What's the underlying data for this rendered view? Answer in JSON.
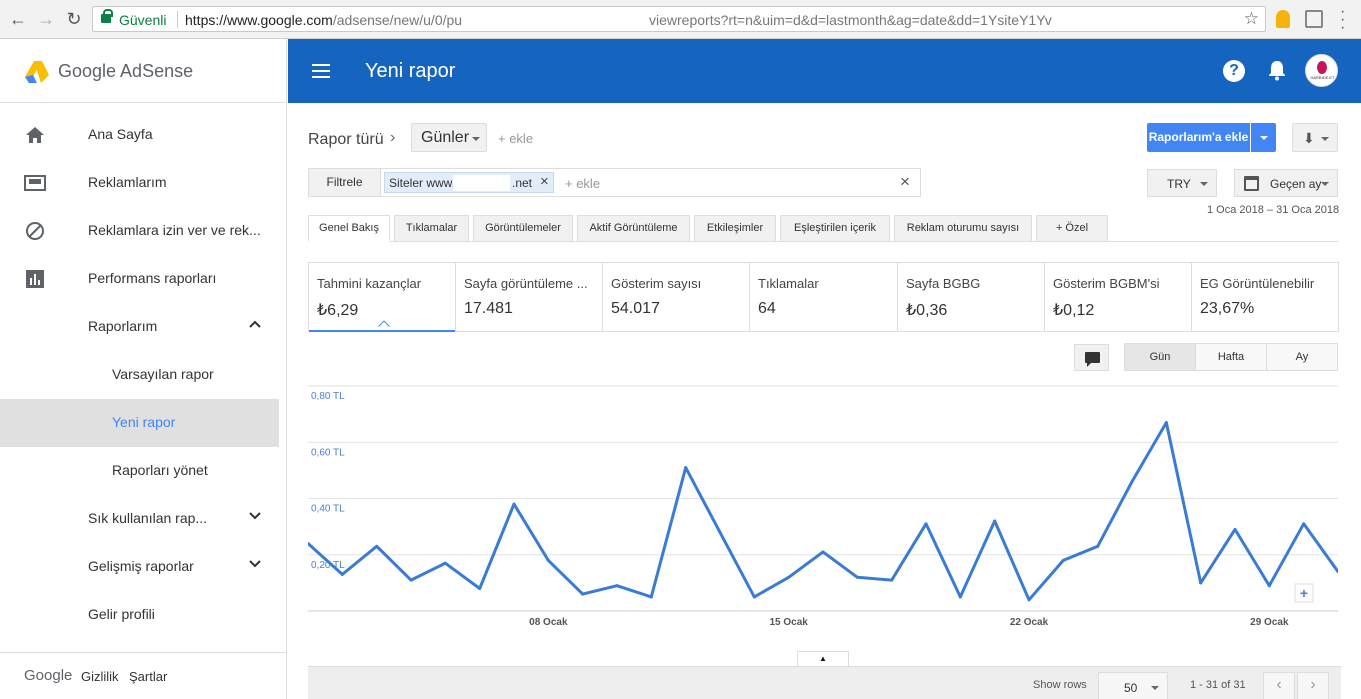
{
  "browser": {
    "secure_label": "Güvenli",
    "url_host": "https://www.google.com",
    "url_path": "/adsense/new/u/0/pu",
    "url_tail": "viewreports?rt=n&uim=d&d=lastmonth&ag=date&dd=1YsiteY1Yv"
  },
  "app": {
    "logo_text": "Google AdSense",
    "page_title": "Yeni rapor"
  },
  "sidebar": {
    "items": [
      {
        "label": "Ana Sayfa",
        "icon": "home-icon"
      },
      {
        "label": "Reklamlarım",
        "icon": "ads-icon"
      },
      {
        "label": "Reklamlara izin ver ve rek...",
        "icon": "block-icon"
      },
      {
        "label": "Performans raporları",
        "icon": "bar-chart-icon"
      },
      {
        "label": "Raporlarım"
      },
      {
        "label": "Varsayılan rapor"
      },
      {
        "label": "Yeni rapor"
      },
      {
        "label": "Raporları yönet"
      },
      {
        "label": "Sık kullanılan rap..."
      },
      {
        "label": "Gelişmiş raporlar"
      },
      {
        "label": "Gelir profili"
      }
    ],
    "footer": {
      "google": "Google",
      "privacy": "Gizlilik",
      "terms": "Şartlar"
    }
  },
  "header": {
    "avatar_text": "HARBIDE.ET"
  },
  "toolbar": {
    "report_type": "Rapor türü",
    "dimension": "Günler",
    "add": "+ ekle",
    "add_to_reports": "Raporlarım'a ekle"
  },
  "filters": {
    "label": "Filtrele",
    "chip_prefix": "Siteler www.",
    "chip_suffix": ".net",
    "add": "+ ekle",
    "currency": "TRY",
    "date_preset": "Geçen ay",
    "date_range": "1 Oca 2018 – 31 Oca 2018"
  },
  "tabs": [
    "Genel Bakış",
    "Tıklamalar",
    "Görüntülemeler",
    "Aktif Görüntüleme",
    "Etkileşimler",
    "Eşleştirilen içerik",
    "Reklam oturumu sayısı",
    "+ Özel"
  ],
  "metrics": [
    {
      "title": "Tahmini kazançlar",
      "value": "₺6,29"
    },
    {
      "title": "Sayfa görüntüleme ...",
      "value": "17.481"
    },
    {
      "title": "Gösterim sayısı",
      "value": "54.017"
    },
    {
      "title": "Tıklamalar",
      "value": "64"
    },
    {
      "title": "Sayfa BGBG",
      "value": "₺0,36"
    },
    {
      "title": "Gösterim BGBM'si",
      "value": "₺0,12"
    },
    {
      "title": "EG Görüntülenebilir",
      "value": "23,67%"
    }
  ],
  "granularity": [
    "Gün",
    "Hafta",
    "Ay"
  ],
  "chart_data": {
    "type": "line",
    "x": [
      "2018-01-01",
      "2018-01-02",
      "2018-01-03",
      "2018-01-04",
      "2018-01-05",
      "2018-01-06",
      "2018-01-07",
      "2018-01-08",
      "2018-01-09",
      "2018-01-10",
      "2018-01-11",
      "2018-01-12",
      "2018-01-13",
      "2018-01-14",
      "2018-01-15",
      "2018-01-16",
      "2018-01-17",
      "2018-01-18",
      "2018-01-19",
      "2018-01-20",
      "2018-01-21",
      "2018-01-22",
      "2018-01-23",
      "2018-01-24",
      "2018-01-25",
      "2018-01-26",
      "2018-01-27",
      "2018-01-28",
      "2018-01-29",
      "2018-01-30",
      "2018-01-31"
    ],
    "values": [
      0.24,
      0.13,
      0.23,
      0.11,
      0.17,
      0.08,
      0.38,
      0.18,
      0.06,
      0.09,
      0.05,
      0.51,
      0.28,
      0.05,
      0.12,
      0.21,
      0.12,
      0.11,
      0.31,
      0.05,
      0.32,
      0.04,
      0.18,
      0.23,
      0.46,
      0.67,
      0.1,
      0.29,
      0.09,
      0.31,
      0.14
    ],
    "yticks": [
      "0,20 TL",
      "0,40 TL",
      "0,60 TL",
      "0,80 TL"
    ],
    "ytick_values": [
      0.2,
      0.4,
      0.6,
      0.8
    ],
    "xticks": [
      "08 Ocak",
      "15 Ocak",
      "22 Ocak",
      "29 Ocak"
    ],
    "xtick_index": [
      7,
      14,
      21,
      28
    ],
    "ylim": [
      0,
      0.8
    ],
    "grid": true,
    "color": "#3a7bd5"
  },
  "table_footer": {
    "show_rows_label": "Show rows",
    "rows": "50",
    "page_info": "1 - 31 of 31"
  }
}
